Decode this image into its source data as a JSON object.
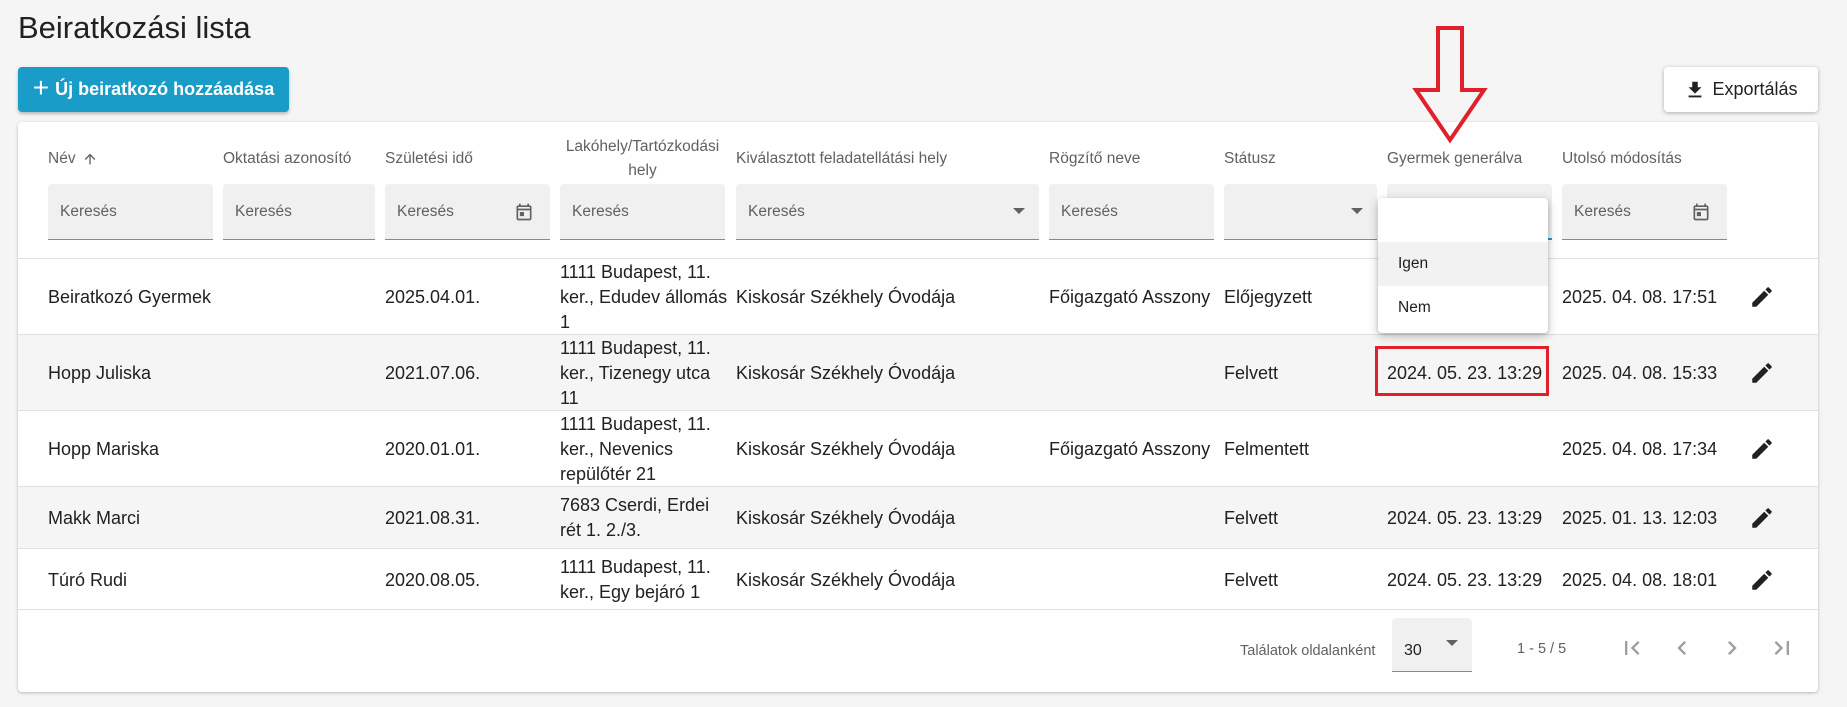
{
  "page": {
    "title": "Beiratkozási lista"
  },
  "toolbar": {
    "add_label": "Új beiratkozó hozzáadása",
    "export_label": "Exportálás"
  },
  "columns": [
    {
      "label": "Név",
      "filter": "Keresés"
    },
    {
      "label": "Oktatási azonosító",
      "filter": "Keresés"
    },
    {
      "label": "Születési idő",
      "filter": "Keresés"
    },
    {
      "label": "Lakóhely/Tartózkodási hely",
      "filter": "Keresés"
    },
    {
      "label": "Kiválasztott feladatellátási hely",
      "filter": "Keresés"
    },
    {
      "label": "Rögzítő neve",
      "filter": "Keresés"
    },
    {
      "label": "Státusz",
      "filter": ""
    },
    {
      "label": "Gyermek generálva",
      "filter": ""
    },
    {
      "label": "Utolsó módosítás",
      "filter": "Keresés"
    }
  ],
  "sort": {
    "column": "Név",
    "direction": "asc"
  },
  "rows": [
    {
      "name": "Beiratkozó Gyermek",
      "edu_id": "",
      "birth": "2025.04.01.",
      "address": "1111 Budapest, 11. ker., Edudev állomás 1",
      "place": "Kiskosár Székhely Óvodája",
      "recorder": "Főigazgató Asszony",
      "status": "Előjegyzett",
      "generated": "",
      "modified": "2025. 04. 08. 17:51"
    },
    {
      "name": "Hopp Juliska",
      "edu_id": "",
      "birth": "2021.07.06.",
      "address": "1111 Budapest, 11. ker., Tizenegy utca 11",
      "place": "Kiskosár Székhely Óvodája",
      "recorder": "",
      "status": "Felvett",
      "generated": "2024. 05. 23. 13:29",
      "modified": "2025. 04. 08. 15:33"
    },
    {
      "name": "Hopp Mariska",
      "edu_id": "",
      "birth": "2020.01.01.",
      "address": "1111 Budapest, 11. ker., Nevenics repülőtér 21",
      "place": "Kiskosár Székhely Óvodája",
      "recorder": "Főigazgató Asszony",
      "status": "Felmentett",
      "generated": "",
      "modified": "2025. 04. 08. 17:34"
    },
    {
      "name": "Makk Marci",
      "edu_id": "",
      "birth": "2021.08.31.",
      "address": "7683 Cserdi, Erdei rét 1. 2./3.",
      "place": "Kiskosár Székhely Óvodája",
      "recorder": "",
      "status": "Felvett",
      "generated": "2024. 05. 23. 13:29",
      "modified": "2025. 01. 13. 12:03"
    },
    {
      "name": "Túró Rudi",
      "edu_id": "",
      "birth": "2020.08.05.",
      "address": "1111 Budapest, 11. ker., Egy bejáró 1",
      "place": "Kiskosár Székhely Óvodája",
      "recorder": "",
      "status": "Felvett",
      "generated": "2024. 05. 23. 13:29",
      "modified": "2025. 04. 08. 18:01"
    }
  ],
  "dropdown": {
    "options": [
      "Igen",
      "Nem"
    ],
    "hovered": "Igen"
  },
  "footer": {
    "per_page_label": "Találatok oldalanként",
    "per_page_value": "30",
    "range": "1 - 5 / 5"
  },
  "icons": {
    "add": "plus-icon",
    "export": "download-icon",
    "sort": "arrow-up-icon",
    "date": "calendar-icon",
    "select": "caret-down-icon",
    "edit": "pencil-icon",
    "first": "first-page-icon",
    "prev": "chevron-left-icon",
    "next": "chevron-right-icon",
    "last": "last-page-icon"
  },
  "colors": {
    "primary": "#1a9cc8",
    "annotation": "#e0202a"
  }
}
